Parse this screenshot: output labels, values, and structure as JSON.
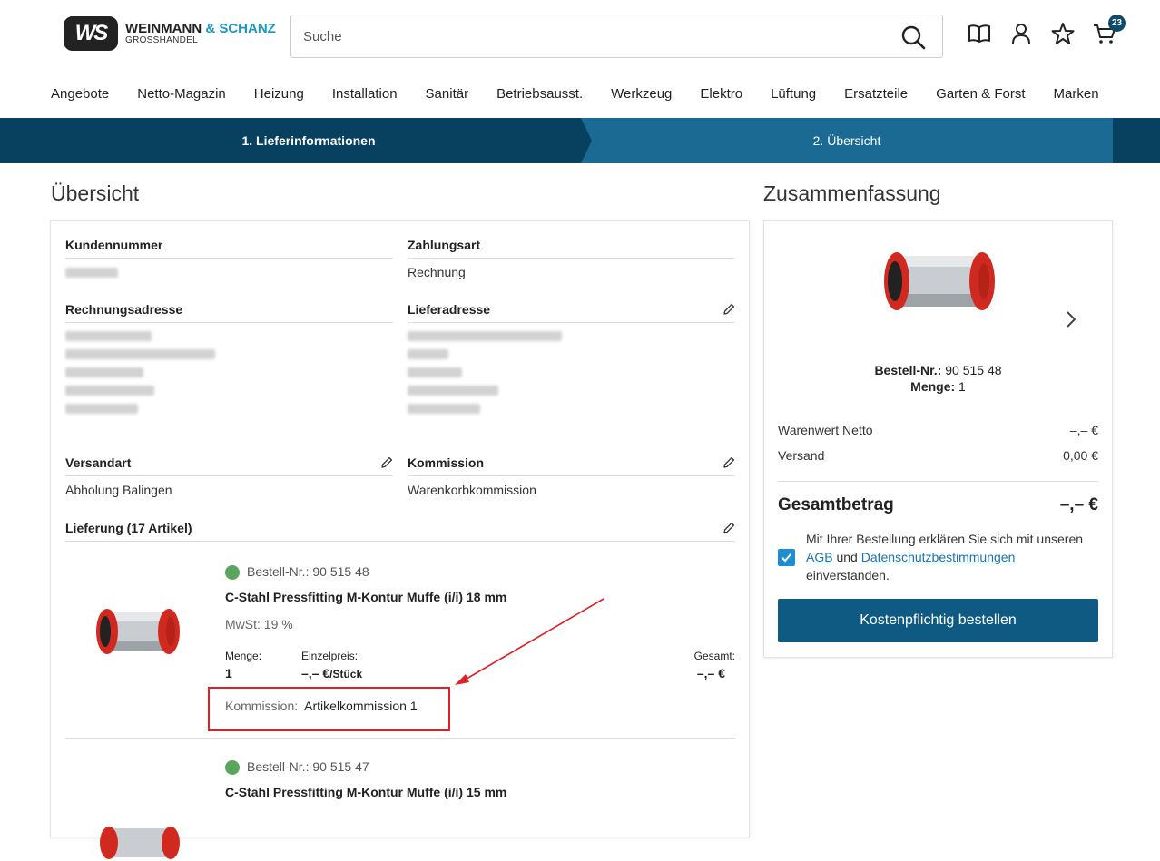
{
  "brand": {
    "mono": "WS",
    "name1": "WEINMANN",
    "name2": "& SCHANZ",
    "sub": "GROSSHANDEL"
  },
  "search": {
    "placeholder": "Suche"
  },
  "cart": {
    "count": "23"
  },
  "nav": [
    "Angebote",
    "Netto-Magazin",
    "Heizung",
    "Installation",
    "Sanitär",
    "Betriebsausst.",
    "Werkzeug",
    "Elektro",
    "Lüftung",
    "Ersatzteile",
    "Garten & Forst",
    "Marken"
  ],
  "steps": {
    "step1": "1. Lieferinformationen",
    "step2": "2. Übersicht"
  },
  "overview": {
    "title": "Übersicht",
    "kundennummer_label": "Kundennummer",
    "zahlungsart_label": "Zahlungsart",
    "zahlungsart_value": "Rechnung",
    "rechnungsadresse_label": "Rechnungsadresse",
    "lieferadresse_label": "Lieferadresse",
    "versandart_label": "Versandart",
    "versandart_value": "Abholung Balingen",
    "kommission_label": "Kommission",
    "kommission_value": "Warenkorbkommission",
    "lieferung_label": "Lieferung (17 Artikel)"
  },
  "items": [
    {
      "bestell_label": "Bestell-Nr.:",
      "bestell_nr": "90 515 48",
      "name": "C-Stahl Pressfitting M-Kontur Muffe (i/i) 18 mm",
      "mwst": "MwSt: 19 %",
      "menge_label": "Menge:",
      "menge": "1",
      "einzelpreis_label": "Einzelpreis:",
      "einzelpreis": "–,– €",
      "einzelpreis_unit": "/Stück",
      "gesamt_label": "Gesamt:",
      "gesamt": "–,– €",
      "kommission_label": "Kommission:",
      "kommission": "Artikelkommission 1"
    },
    {
      "bestell_label": "Bestell-Nr.:",
      "bestell_nr": "90 515 47",
      "name": "C-Stahl Pressfitting M-Kontur Muffe (i/i) 15 mm"
    }
  ],
  "summary": {
    "title": "Zusammenfassung",
    "bestell_label": "Bestell-Nr.:",
    "bestell_nr": "90 515 48",
    "menge_label": "Menge:",
    "menge": "1",
    "warenwert_label": "Warenwert Netto",
    "warenwert_value": "–,– €",
    "versand_label": "Versand",
    "versand_value": "0,00 €",
    "gesamt_label": "Gesamtbetrag",
    "gesamt_value": "–,– €",
    "terms_pre": "Mit Ihrer Bestellung erklären Sie sich mit unseren",
    "terms_agb": "AGB",
    "terms_und": "und",
    "terms_ds": "Datenschutzbestimmungen",
    "terms_post": "einverstanden.",
    "order_button": "Kostenpflichtig bestellen"
  },
  "colors": {
    "primary": "#0f5a82",
    "step_dark": "#08405f",
    "step_light": "#1a6a93",
    "accent_blue": "#1a95c4",
    "available": "#5aa65e",
    "highlight_red": "#e01f26"
  }
}
